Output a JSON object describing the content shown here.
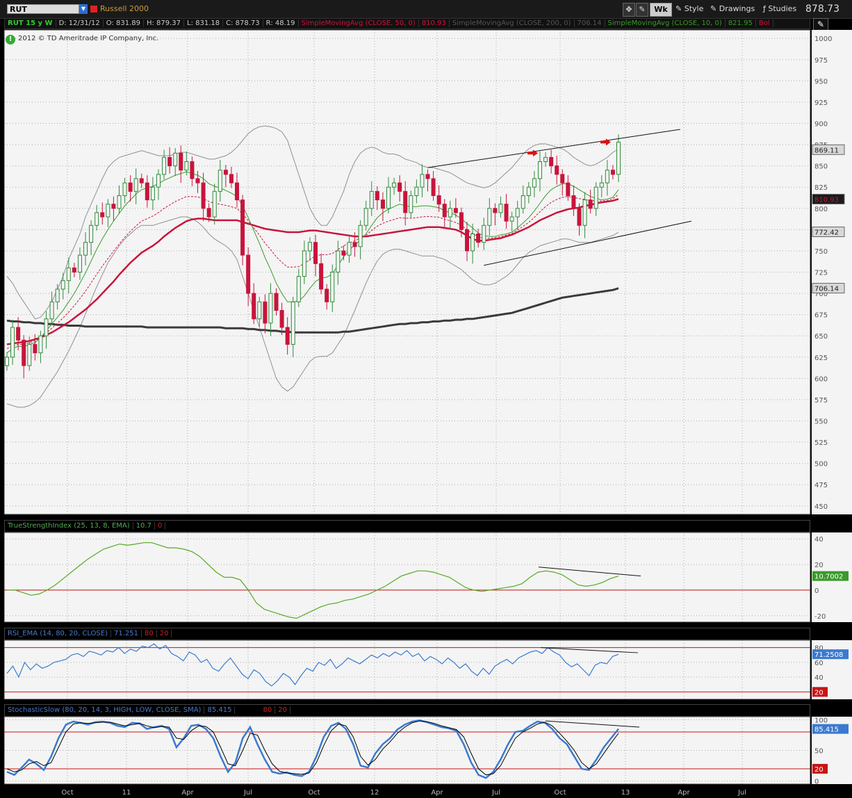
{
  "header": {
    "symbol": "RUT",
    "symbol_name": "Russell 2000",
    "timeframe_button": "Wk",
    "style_label": "Style",
    "drawings_label": "Drawings",
    "studies_label": "Studies",
    "last_price": "878.73"
  },
  "info": {
    "chart_label": "RUT 15 y W",
    "date": "D: 12/31/12",
    "open": "O: 831.89",
    "high": "H: 879.37",
    "low": "L: 831.18",
    "close": "C: 878.73",
    "range": "R: 48.19",
    "sma50_label": "SimpleMovingAvg (CLOSE, 50, 0)",
    "sma50_value": "810.93",
    "sma200_label": "SimpleMovingAvg (CLOSE, 200, 0)",
    "sma200_value": "706.14",
    "sma10_label": "SimpleMovingAvg (CLOSE, 10, 0)",
    "sma10_value": "821.95",
    "bollinger_label": "Bol"
  },
  "copyright": "2012 © TD Ameritrade IP Company, Inc.",
  "colors": {
    "sma50": "#c8143c",
    "sma200": "#3a3a3a",
    "sma10": "#3a9a2a",
    "bollinger": "#909090",
    "candle_up": "#2e8b3a",
    "candle_down": "#c8143c",
    "tsi": "#55aa22",
    "rsi": "#3a7ad0",
    "stoch_k": "#3a7ad0",
    "stoch_d": "#000000",
    "level_line": "#c81414"
  },
  "chart_data": [
    {
      "type": "candlestick",
      "title": "RUT 15 y W",
      "ylim": [
        440,
        1010
      ],
      "yticks": [
        450,
        475,
        500,
        525,
        550,
        575,
        600,
        625,
        650,
        675,
        700,
        725,
        750,
        775,
        800,
        825,
        850,
        875,
        900,
        925,
        950,
        975,
        1000
      ],
      "xticks": [
        "Oct",
        "11",
        "Apr",
        "Jul",
        "Oct",
        "12",
        "Apr",
        "Jul",
        "Oct",
        "13",
        "Apr",
        "Jul"
      ],
      "grid": true,
      "price_labels": [
        {
          "value": "869.11",
          "price": 869.11,
          "color": "#d8d8d8"
        },
        {
          "value": "810.93",
          "price": 810.93,
          "color": "#c8143c"
        },
        {
          "value": "772.42",
          "price": 772.42,
          "color": "#d8d8d8"
        },
        {
          "value": "706.14",
          "price": 706.14,
          "color": "#d8d8d8"
        }
      ],
      "closes": [
        625,
        660,
        645,
        615,
        640,
        630,
        650,
        670,
        690,
        705,
        715,
        730,
        725,
        745,
        760,
        780,
        795,
        790,
        805,
        800,
        815,
        830,
        820,
        835,
        830,
        810,
        825,
        840,
        860,
        850,
        865,
        845,
        855,
        835,
        830,
        800,
        790,
        820,
        845,
        840,
        830,
        810,
        745,
        700,
        670,
        690,
        665,
        700,
        680,
        660,
        640,
        690,
        720,
        750,
        760,
        735,
        705,
        690,
        725,
        750,
        745,
        760,
        755,
        780,
        800,
        820,
        810,
        800,
        825,
        830,
        820,
        795,
        815,
        825,
        840,
        835,
        815,
        805,
        790,
        800,
        795,
        775,
        750,
        770,
        760,
        780,
        800,
        795,
        805,
        785,
        790,
        800,
        815,
        825,
        835,
        855,
        860,
        850,
        840,
        830,
        815,
        800,
        780,
        810,
        800,
        825,
        830,
        845,
        840,
        878
      ],
      "sma10": [
        630,
        635,
        638,
        637,
        640,
        642,
        648,
        656,
        664,
        672,
        680,
        690,
        700,
        712,
        724,
        738,
        752,
        764,
        775,
        785,
        794,
        803,
        810,
        817,
        822,
        824,
        826,
        829,
        833,
        836,
        839,
        841,
        843,
        841,
        839,
        835,
        829,
        826,
        824,
        821,
        818,
        814,
        803,
        789,
        774,
        759,
        742,
        728,
        712,
        700,
        690,
        690,
        691,
        697,
        706,
        714,
        718,
        719,
        723,
        733,
        743,
        751,
        757,
        763,
        770,
        780,
        789,
        795,
        799,
        802,
        805,
        803,
        802,
        802,
        803,
        803,
        802,
        801,
        797,
        795,
        792,
        788,
        782,
        777,
        771,
        768,
        767,
        767,
        769,
        770,
        772,
        777,
        783,
        789,
        797,
        806,
        815,
        822,
        826,
        829,
        829,
        826,
        822,
        818,
        814,
        812,
        810,
        811,
        813,
        822
      ],
      "sma50": [
        640,
        641,
        642,
        643,
        644,
        646,
        648,
        651,
        654,
        658,
        662,
        666,
        671,
        676,
        681,
        687,
        693,
        700,
        707,
        714,
        722,
        729,
        736,
        742,
        748,
        752,
        756,
        761,
        767,
        772,
        777,
        781,
        785,
        787,
        788,
        788,
        787,
        786,
        786,
        786,
        786,
        786,
        784,
        782,
        780,
        778,
        776,
        775,
        774,
        773,
        772,
        772,
        772,
        773,
        774,
        774,
        773,
        772,
        771,
        770,
        769,
        768,
        767,
        767,
        767,
        768,
        769,
        770,
        771,
        772,
        773,
        774,
        775,
        776,
        777,
        778,
        778,
        778,
        777,
        776,
        775,
        772,
        768,
        764,
        762,
        762,
        763,
        764,
        765,
        767,
        769,
        772,
        775,
        778,
        782,
        786,
        789,
        792,
        795,
        797,
        799,
        800,
        801,
        803,
        804,
        806,
        807,
        808,
        809,
        811
      ],
      "sma200": [
        668,
        667,
        667,
        666,
        666,
        665,
        665,
        664,
        664,
        663,
        663,
        662,
        662,
        662,
        661,
        661,
        661,
        661,
        661,
        661,
        661,
        661,
        661,
        661,
        661,
        660,
        660,
        660,
        660,
        660,
        660,
        660,
        660,
        660,
        660,
        660,
        660,
        660,
        660,
        659,
        659,
        659,
        659,
        658,
        658,
        657,
        657,
        656,
        656,
        655,
        655,
        654,
        654,
        654,
        654,
        654,
        654,
        654,
        654,
        654,
        655,
        655,
        656,
        657,
        658,
        659,
        660,
        661,
        662,
        663,
        664,
        664,
        665,
        665,
        666,
        666,
        667,
        667,
        668,
        668,
        669,
        669,
        670,
        670,
        671,
        672,
        673,
        674,
        675,
        676,
        677,
        679,
        681,
        683,
        685,
        687,
        689,
        691,
        693,
        695,
        696,
        697,
        698,
        699,
        700,
        701,
        702,
        703,
        704,
        706
      ],
      "boll_upper": [
        720,
        712,
        700,
        690,
        680,
        670,
        672,
        680,
        690,
        705,
        720,
        740,
        755,
        770,
        790,
        805,
        820,
        835,
        848,
        855,
        860,
        862,
        864,
        866,
        868,
        866,
        864,
        862,
        862,
        862,
        864,
        866,
        866,
        864,
        862,
        860,
        858,
        858,
        860,
        862,
        866,
        872,
        880,
        888,
        893,
        896,
        897,
        896,
        894,
        890,
        880,
        860,
        840,
        820,
        800,
        788,
        780,
        780,
        790,
        805,
        820,
        840,
        855,
        865,
        870,
        872,
        870,
        866,
        864,
        864,
        862,
        858,
        856,
        854,
        850,
        848,
        848,
        846,
        844,
        842,
        838,
        834,
        830,
        828,
        826,
        824,
        826,
        830,
        836,
        842,
        848,
        856,
        864,
        870,
        874,
        876,
        876,
        874,
        872,
        870,
        866,
        860,
        856,
        852,
        850,
        852,
        856,
        860,
        866,
        870
      ],
      "boll_lower": [
        570,
        568,
        566,
        566,
        568,
        572,
        578,
        588,
        598,
        608,
        620,
        632,
        646,
        660,
        676,
        692,
        708,
        722,
        736,
        746,
        756,
        764,
        770,
        776,
        780,
        780,
        780,
        782,
        784,
        786,
        788,
        790,
        790,
        788,
        784,
        778,
        770,
        764,
        760,
        756,
        750,
        740,
        720,
        700,
        680,
        660,
        640,
        620,
        600,
        590,
        585,
        590,
        600,
        610,
        620,
        625,
        626,
        626,
        630,
        640,
        650,
        665,
        680,
        696,
        712,
        726,
        738,
        746,
        750,
        752,
        752,
        750,
        748,
        746,
        744,
        744,
        744,
        742,
        740,
        736,
        732,
        728,
        722,
        716,
        712,
        710,
        710,
        712,
        716,
        720,
        726,
        734,
        742,
        748,
        752,
        756,
        758,
        760,
        762,
        764,
        764,
        762,
        760,
        760,
        760,
        762,
        764,
        766,
        768,
        772
      ]
    },
    {
      "type": "line",
      "title": "TrueStrengthIndex (25, 13, 8, EMA)",
      "params_value": "10.7",
      "params_value2": "0",
      "last_label": "10.7002",
      "ylim": [
        -25,
        45
      ],
      "yticks": [
        -20,
        0,
        20,
        40
      ],
      "series": [
        {
          "name": "TSI",
          "values": [
            0,
            0,
            -2,
            -4,
            -3,
            0,
            4,
            9,
            14,
            19,
            24,
            28,
            32,
            34,
            36,
            35,
            36,
            37,
            37,
            35,
            33,
            33,
            32,
            30,
            26,
            20,
            14,
            10,
            10,
            8,
            0,
            -10,
            -15,
            -17,
            -19,
            -21,
            -22,
            -19,
            -16,
            -13,
            -11,
            -10,
            -8,
            -7,
            -5,
            -3,
            0,
            3,
            7,
            11,
            13,
            15,
            15,
            14,
            12,
            10,
            6,
            2,
            0,
            -1,
            0,
            1,
            2,
            3,
            5,
            10,
            14,
            15,
            14,
            12,
            8,
            4,
            3,
            4,
            6,
            9,
            11
          ]
        }
      ],
      "levels": [
        0
      ]
    },
    {
      "type": "line",
      "title": "RSI_EMA (14, 80, 20, CLOSE)",
      "params_value": "71.251",
      "overbought": "80",
      "oversold": "20",
      "last_label": "71.2508",
      "ylim": [
        10,
        90
      ],
      "yticks": [
        40,
        60,
        80
      ],
      "series": [
        {
          "name": "RSI",
          "values": [
            45,
            55,
            40,
            60,
            50,
            58,
            52,
            55,
            60,
            62,
            64,
            70,
            72,
            68,
            75,
            73,
            70,
            76,
            74,
            80,
            72,
            78,
            75,
            82,
            80,
            85,
            78,
            83,
            72,
            68,
            62,
            74,
            70,
            60,
            64,
            52,
            48,
            58,
            66,
            55,
            44,
            38,
            50,
            45,
            34,
            28,
            35,
            45,
            40,
            30,
            42,
            52,
            48,
            60,
            56,
            64,
            52,
            58,
            66,
            62,
            58,
            64,
            70,
            66,
            72,
            68,
            74,
            70,
            76,
            68,
            72,
            62,
            68,
            64,
            58,
            66,
            60,
            52,
            58,
            48,
            42,
            52,
            44,
            55,
            60,
            64,
            58,
            66,
            70,
            74,
            76,
            72,
            80,
            74,
            70,
            60,
            54,
            58,
            50,
            42,
            56,
            60,
            58,
            68,
            71
          ]
        }
      ],
      "levels": [
        80,
        20
      ]
    },
    {
      "type": "line",
      "title": "StochasticSlow (80, 20, 14, 3, HIGH, LOW, CLOSE, SMA)",
      "params_value": "85.415",
      "overbought": "80",
      "oversold": "20",
      "last_label": "85.415",
      "ylim": [
        -5,
        105
      ],
      "yticks": [
        0,
        50,
        100
      ],
      "series": [
        {
          "name": "SlowK",
          "values": [
            15,
            10,
            22,
            35,
            28,
            18,
            40,
            70,
            92,
            97,
            95,
            92,
            96,
            97,
            95,
            90,
            88,
            95,
            94,
            85,
            88,
            90,
            85,
            55,
            70,
            90,
            92,
            85,
            70,
            40,
            15,
            30,
            70,
            88,
            60,
            35,
            15,
            12,
            14,
            10,
            8,
            15,
            40,
            72,
            90,
            95,
            85,
            60,
            25,
            22,
            45,
            60,
            70,
            84,
            92,
            97,
            99,
            96,
            92,
            88,
            86,
            82,
            60,
            30,
            10,
            5,
            15,
            35,
            60,
            80,
            82,
            90,
            97,
            95,
            85,
            70,
            60,
            40,
            20,
            18,
            35,
            55,
            70,
            85
          ]
        },
        {
          "name": "SlowD",
          "values": [
            20,
            15,
            18,
            28,
            32,
            25,
            30,
            55,
            80,
            93,
            95,
            94,
            95,
            96,
            96,
            93,
            90,
            92,
            94,
            90,
            87,
            89,
            88,
            70,
            68,
            82,
            90,
            89,
            80,
            55,
            28,
            25,
            50,
            78,
            75,
            50,
            28,
            16,
            13,
            12,
            11,
            13,
            30,
            58,
            82,
            93,
            90,
            72,
            40,
            26,
            35,
            52,
            64,
            78,
            88,
            95,
            98,
            97,
            94,
            90,
            87,
            84,
            72,
            45,
            20,
            10,
            12,
            25,
            48,
            70,
            80,
            86,
            93,
            96,
            90,
            78,
            65,
            50,
            30,
            20,
            28,
            45,
            62,
            78
          ]
        }
      ],
      "levels": [
        80,
        20
      ]
    }
  ]
}
